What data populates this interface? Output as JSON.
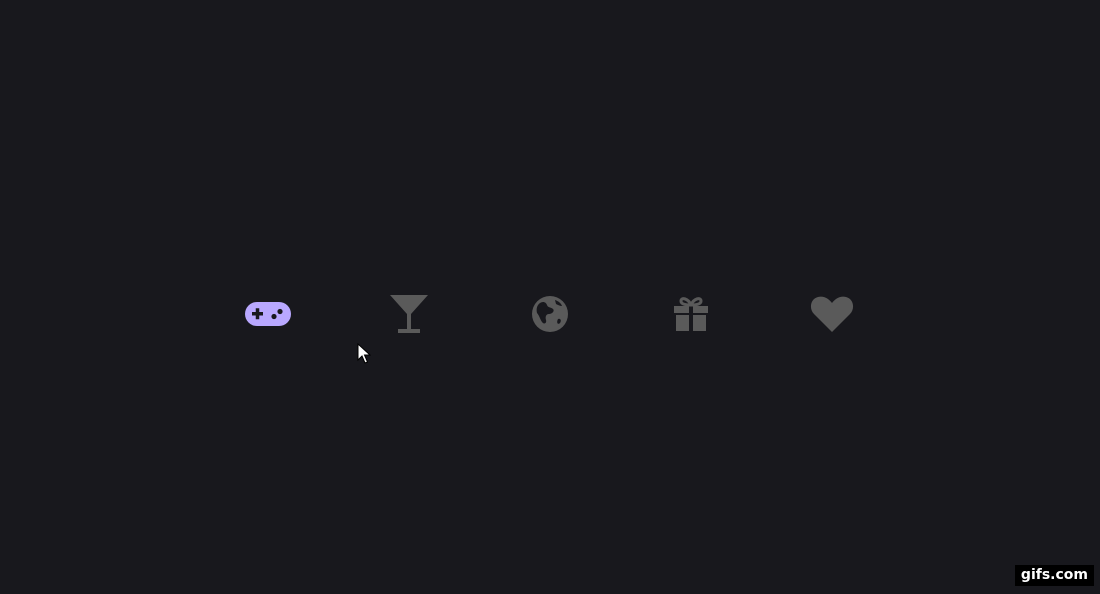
{
  "icons": [
    {
      "name": "gamepad-icon",
      "active": true
    },
    {
      "name": "cocktail-icon",
      "active": false
    },
    {
      "name": "globe-icon",
      "active": false
    },
    {
      "name": "gift-icon",
      "active": false
    },
    {
      "name": "heart-icon",
      "active": false
    }
  ],
  "colors": {
    "background": "#18181d",
    "active": "#b9a8ff",
    "inactive": "#5a5a5a"
  },
  "cursor": {
    "icon": "mouse-pointer-icon"
  },
  "watermark": {
    "text": "gifs.com"
  }
}
